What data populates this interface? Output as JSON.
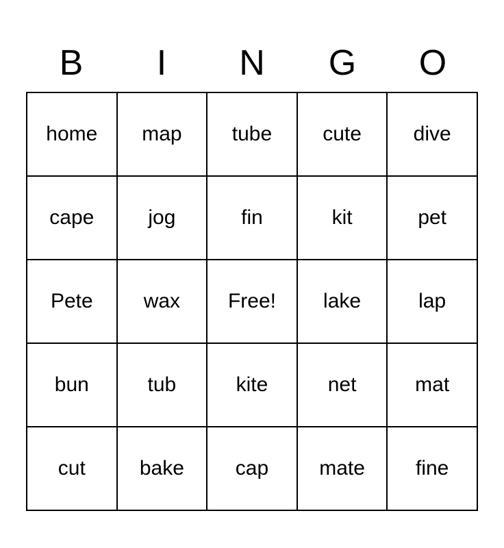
{
  "header": {
    "letters": [
      "B",
      "I",
      "N",
      "G",
      "O"
    ]
  },
  "grid": {
    "rows": [
      [
        "home",
        "map",
        "tube",
        "cute",
        "dive"
      ],
      [
        "cape",
        "jog",
        "fin",
        "kit",
        "pet"
      ],
      [
        "Pete",
        "wax",
        "Free!",
        "lake",
        "lap"
      ],
      [
        "bun",
        "tub",
        "kite",
        "net",
        "mat"
      ],
      [
        "cut",
        "bake",
        "cap",
        "mate",
        "fine"
      ]
    ]
  }
}
